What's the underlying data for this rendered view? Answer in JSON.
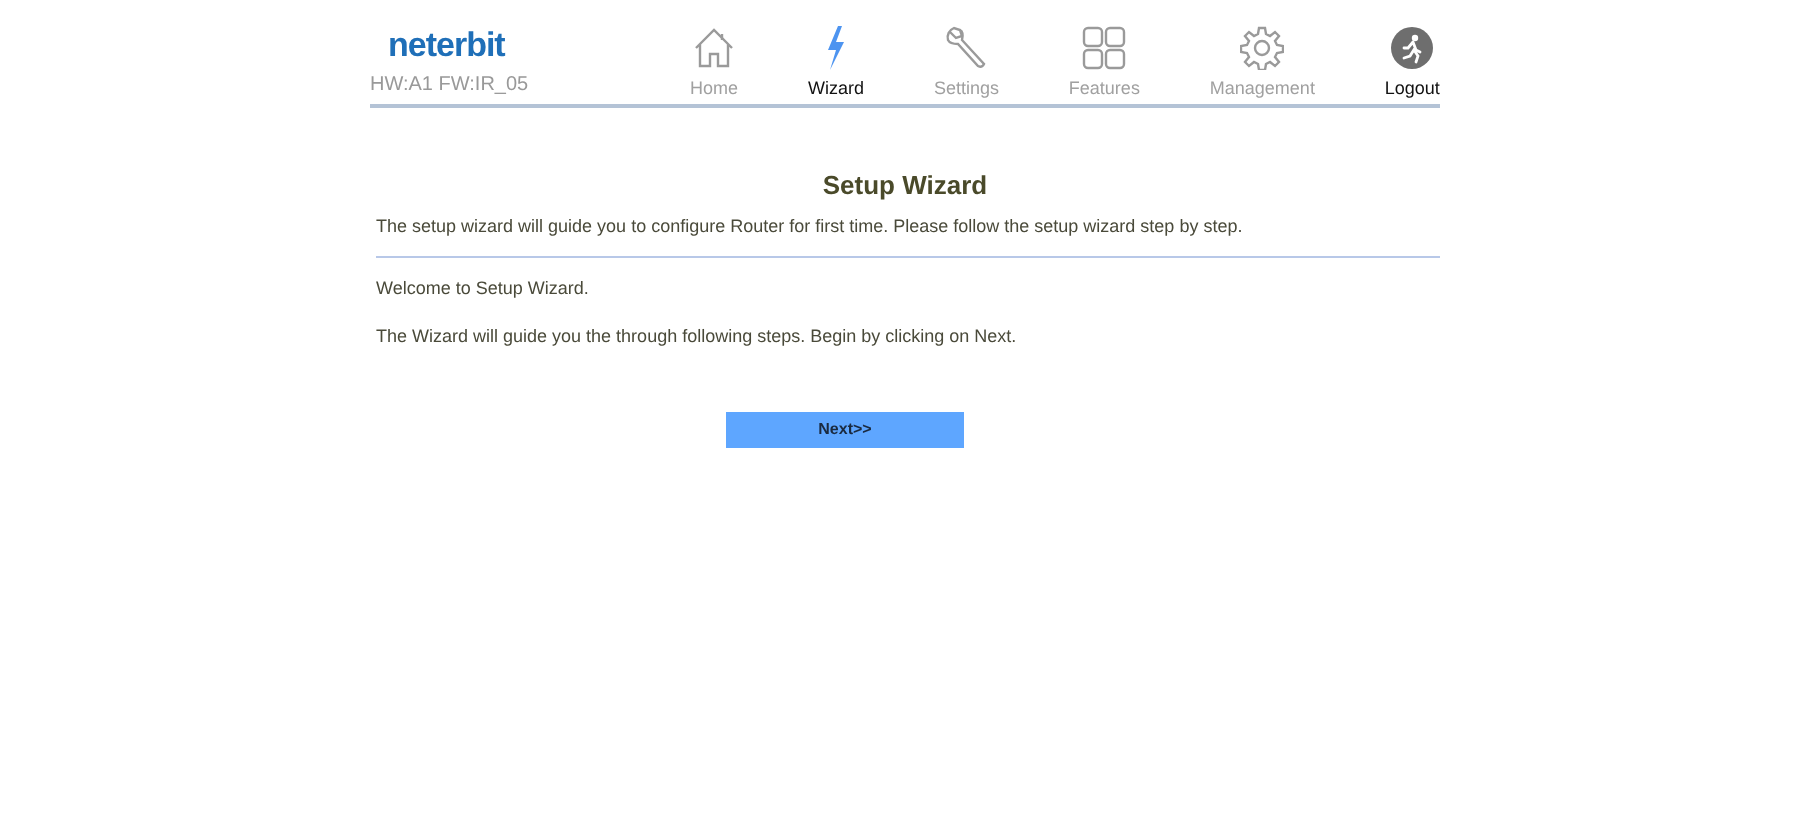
{
  "header": {
    "logo": "neterbit",
    "version": "HW:A1 FW:IR_05"
  },
  "nav": [
    {
      "kind": "home",
      "label": "Home",
      "selected": false
    },
    {
      "kind": "wizard",
      "label": "Wizard",
      "selected": true
    },
    {
      "kind": "settings",
      "label": "Settings",
      "selected": false
    },
    {
      "kind": "features",
      "label": "Features",
      "selected": false
    },
    {
      "kind": "management",
      "label": "Management",
      "selected": false
    },
    {
      "kind": "logout",
      "label": "Logout",
      "selected": false
    }
  ],
  "content": {
    "title": "Setup Wizard",
    "description": "The setup wizard will guide you to configure Router for first time. Please follow the setup wizard step by step.",
    "paragraphs": [
      "Welcome to Setup Wizard.",
      "The Wizard will guide you the through following steps. Begin by clicking on Next."
    ],
    "button": "Next>>"
  }
}
